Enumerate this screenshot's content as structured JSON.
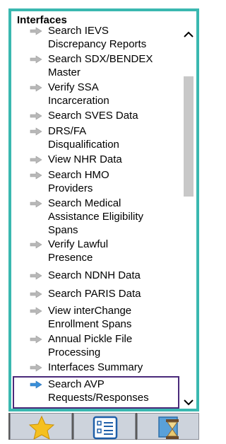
{
  "panel": {
    "title": "Interfaces",
    "items": [
      {
        "label": "Search IEVS\nDiscrepancy Reports"
      },
      {
        "label": "Search SDX/BENDEX\nMaster"
      },
      {
        "label": "Verify SSA\nIncarceration"
      },
      {
        "label": "Search SVES Data"
      },
      {
        "label": "DRS/FA\nDisqualification"
      },
      {
        "label": "View NHR Data"
      },
      {
        "label": "Search HMO\nProviders"
      },
      {
        "label": "Search Medical\nAssistance Eligibility\nSpans"
      },
      {
        "label": "Verify Lawful\nPresence"
      },
      {
        "label": "Search NDNH Data"
      },
      {
        "label": "Search PARIS Data"
      },
      {
        "label": "View interChange\nEnrollment Spans"
      },
      {
        "label": "Annual Pickle File\nProcessing"
      },
      {
        "label": "Interfaces Summary"
      },
      {
        "label": "Search AVP\nRequests/Responses",
        "selected": true
      }
    ]
  },
  "colors": {
    "panel_border": "#3ab8b0",
    "selection_border": "#4a2a7a",
    "arrow_gray": "#b8b8b8",
    "arrow_blue": "#3a8fd8",
    "toolbar_bg": "#5a5a5a"
  },
  "toolbar": {
    "buttons": [
      {
        "icon": "star-icon"
      },
      {
        "icon": "list-icon"
      },
      {
        "icon": "hourglass-icon"
      }
    ]
  }
}
